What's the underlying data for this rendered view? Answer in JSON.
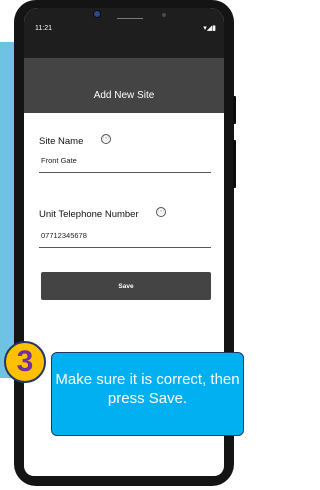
{
  "status_bar": {
    "time": "11:21",
    "icons": "▾◢▮",
    "icon_names": [
      "wifi-icon",
      "signal-icon",
      "battery-icon"
    ]
  },
  "app": {
    "title": "Add New Site"
  },
  "form": {
    "site_name": {
      "label": "Site Name",
      "info_glyph": "ⓘ",
      "value": "Front Gate"
    },
    "unit_telephone": {
      "label": "Unit Telephone Number",
      "info_glyph": "ⓘ",
      "value": "07712345678"
    },
    "save_label": "Save"
  },
  "callout": {
    "step": "3",
    "text": "Make sure it is correct, then press Save."
  },
  "colors": {
    "callout_fill": "#00b0f0",
    "badge_fill": "#ffc000",
    "badge_number": "#7030a0",
    "header_gray": "#444444"
  }
}
